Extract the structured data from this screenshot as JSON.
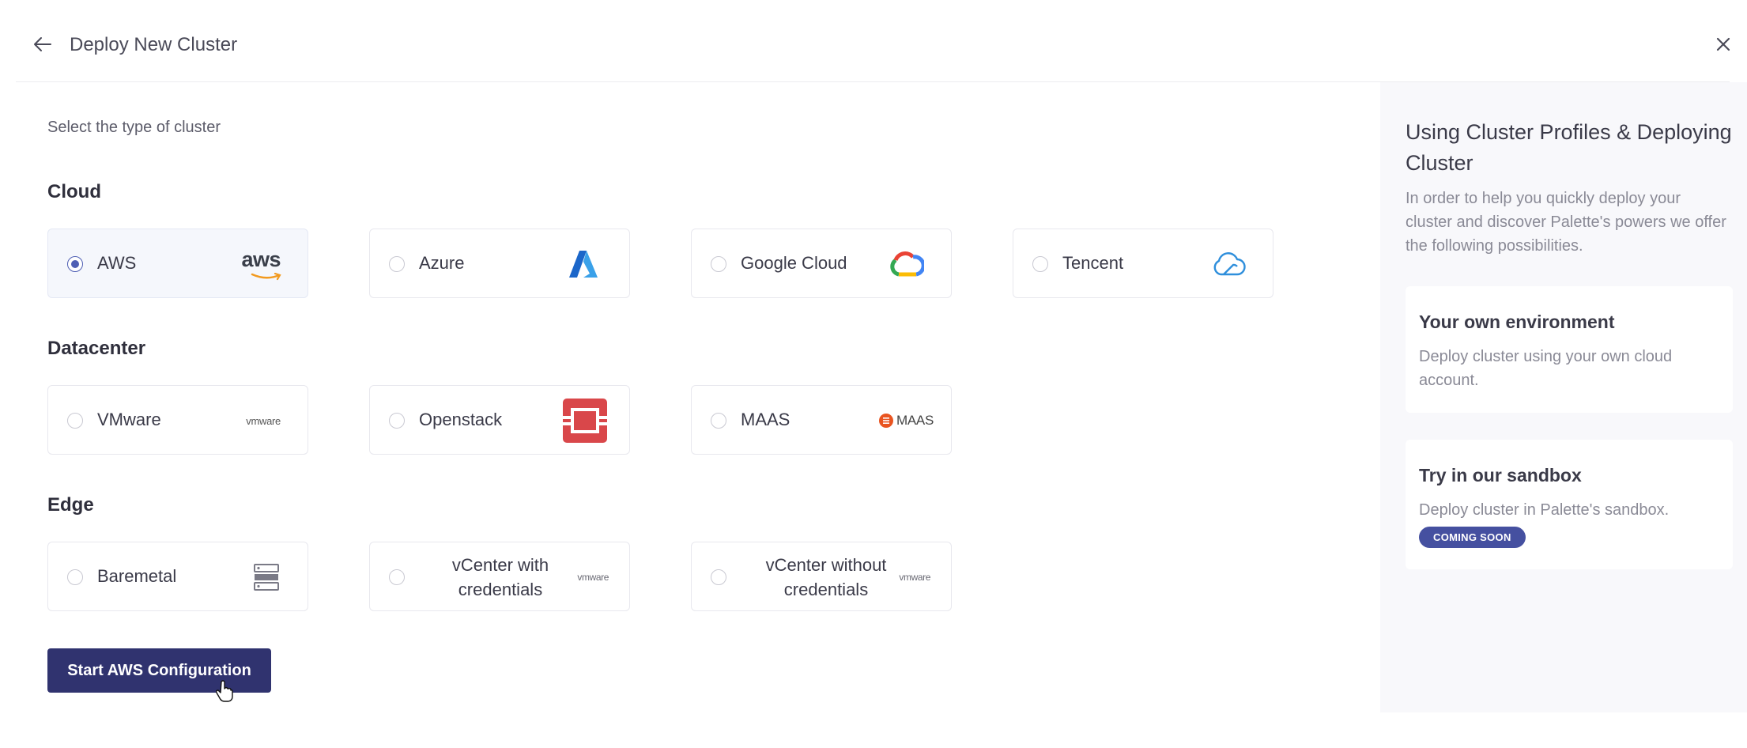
{
  "header": {
    "title": "Deploy New Cluster"
  },
  "main": {
    "subtitle": "Select the type of cluster",
    "sections": [
      {
        "title": "Cloud",
        "options": [
          {
            "label": "AWS",
            "logo": "aws-logo",
            "selected": true
          },
          {
            "label": "Azure",
            "logo": "azure-logo",
            "selected": false
          },
          {
            "label": "Google Cloud",
            "logo": "google-cloud-logo",
            "selected": false
          },
          {
            "label": "Tencent",
            "logo": "tencent-cloud-logo",
            "selected": false
          }
        ]
      },
      {
        "title": "Datacenter",
        "options": [
          {
            "label": "VMware",
            "logo": "vmware-logo",
            "logo_text": "vmware",
            "selected": false
          },
          {
            "label": "Openstack",
            "logo": "openstack-logo",
            "selected": false
          },
          {
            "label": "MAAS",
            "logo": "maas-logo",
            "logo_text": "MAAS",
            "selected": false
          }
        ]
      },
      {
        "title": "Edge",
        "options": [
          {
            "label": "Baremetal",
            "logo": "server-icon",
            "selected": false
          },
          {
            "label": "vCenter with credentials",
            "logo": "vmware-logo",
            "logo_text": "vmware",
            "selected": false
          },
          {
            "label": "vCenter without credentials",
            "logo": "vmware-logo",
            "logo_text": "vmware",
            "selected": false
          }
        ]
      }
    ],
    "primary_button": "Start AWS Configuration"
  },
  "side_panel": {
    "title": "Using Cluster Profiles & Deploying Cluster",
    "description": "In order to help you quickly deploy your cluster and discover Palette's powers we offer the following possibilities.",
    "cards": [
      {
        "title": "Your own environment",
        "description": "Deploy cluster using your own cloud account."
      },
      {
        "title": "Try in our sandbox",
        "description": "Deploy cluster in Palette's sandbox.",
        "badge": "COMING SOON"
      }
    ]
  },
  "colors": {
    "primary": "#30336f",
    "radio_selected": "#4f5fb4",
    "badge": "#4550a0",
    "side_panel_bg": "#f8f8fb",
    "openstack_red": "#d9474a"
  }
}
